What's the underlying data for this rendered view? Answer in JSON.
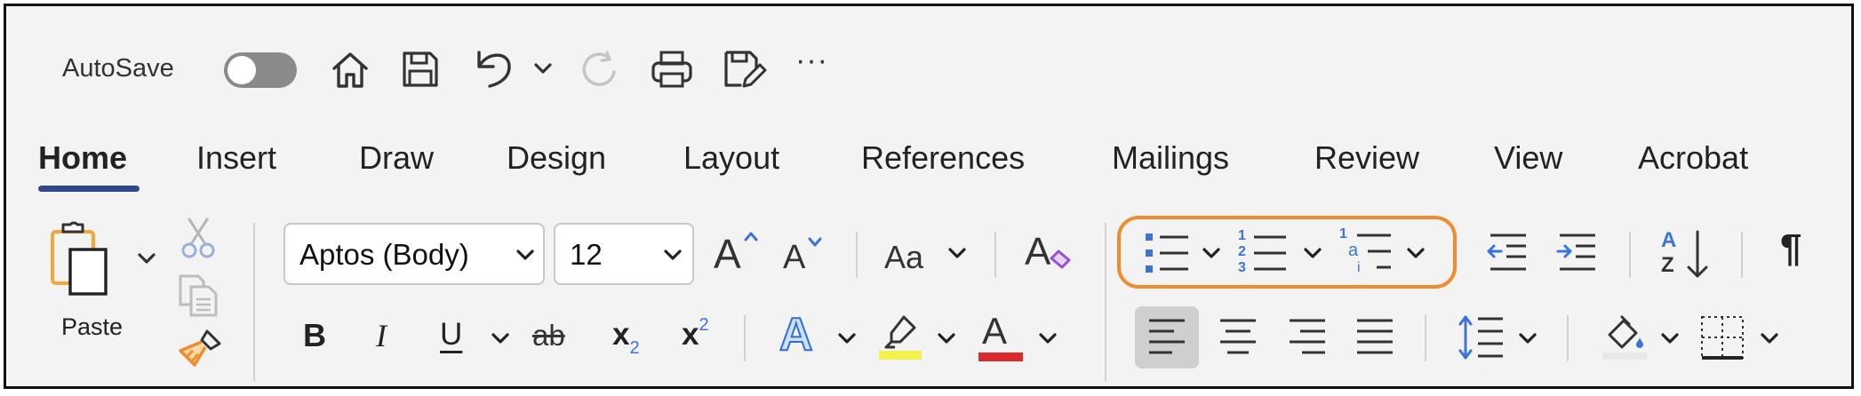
{
  "quick_access": {
    "autosave_label": "AutoSave",
    "autosave_on": false,
    "icons": [
      "home-icon",
      "save-icon",
      "undo-icon",
      "chevron-down-icon",
      "redo-icon",
      "print-icon",
      "save-as-icon",
      "more-icon"
    ],
    "more_label": "···"
  },
  "tabs": [
    {
      "label": "Home",
      "active": true
    },
    {
      "label": "Insert"
    },
    {
      "label": "Draw"
    },
    {
      "label": "Design"
    },
    {
      "label": "Layout"
    },
    {
      "label": "References"
    },
    {
      "label": "Mailings"
    },
    {
      "label": "Review"
    },
    {
      "label": "View"
    },
    {
      "label": "Acrobat"
    }
  ],
  "clipboard": {
    "paste_label": "Paste"
  },
  "font": {
    "font_name": "Aptos (Body)",
    "font_size": "12",
    "grow_label": "A",
    "shrink_label": "A",
    "change_case_label": "Aa",
    "clear_format_label": "A"
  },
  "format": {
    "bold": "B",
    "italic": "I",
    "underline": "U",
    "strike": "ab",
    "subscript_base": "x",
    "subscript_mark": "2",
    "superscript_base": "x",
    "superscript_mark": "2",
    "text_effects": "A",
    "font_color": "A"
  },
  "paragraph": {
    "multilevel_top": "1",
    "multilevel_mid": "a",
    "multilevel_bot": "i",
    "numbering_marks": [
      "1",
      "2",
      "3"
    ],
    "sort_top": "A",
    "sort_bottom": "Z",
    "pilcrow": "¶"
  },
  "colors": {
    "highlight": "#f3f24a",
    "font_color": "#d92b2b",
    "accent": "#2f4a8c",
    "selection_outline": "#f08c2e",
    "bullet_blue": "#3b74d9",
    "clipboard_orange": "#f5a63a"
  }
}
